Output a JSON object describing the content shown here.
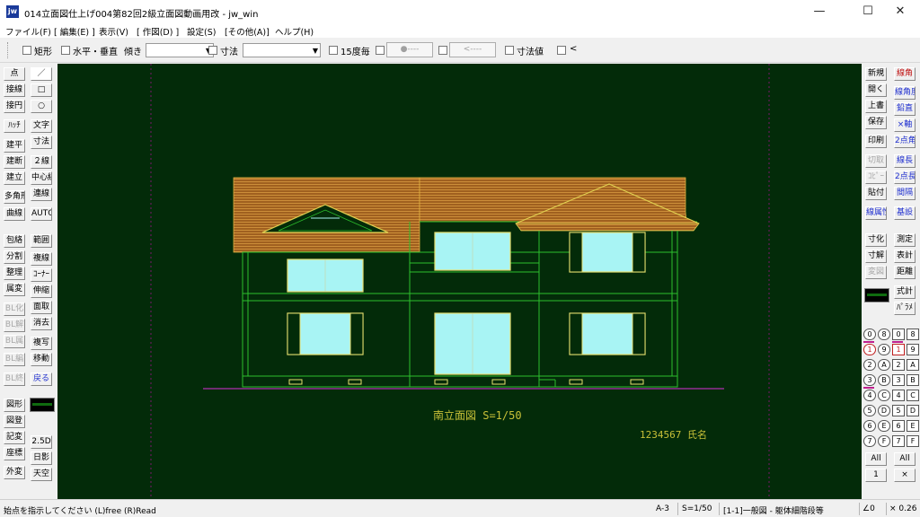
{
  "window": {
    "title": "014立面図仕上げ004第82回2級立面図動画用改 - jw_win",
    "app_icon": "jw",
    "controls": {
      "minimize": "—",
      "maximize": "☐",
      "close": "✕"
    }
  },
  "menu": [
    "ファイル(F)",
    "[ 編集(E) ]",
    "表示(V)",
    "[ 作図(D) ]",
    "設定(S)",
    "[その他(A)]",
    "ヘルプ(H)"
  ],
  "toolbar": {
    "rectangle": "矩形",
    "horiz_vert": "水平・垂直",
    "slope_label": "傾き",
    "slope_value": "",
    "dimension_label": "寸法",
    "dimension_value": "",
    "degree15": "15度毎",
    "btn_point": "●‐‐‐‐",
    "btn_arrow": "<‐‐‐‐",
    "dim_value": "寸法値",
    "lt": "<"
  },
  "left_panel": {
    "col1": [
      "点",
      "接線",
      "接円",
      "ﾊｯﾁ",
      "建平",
      "建断",
      "建立",
      "多角形",
      "曲線",
      "包絡",
      "分割",
      "整理",
      "属変",
      "BL化",
      "BL解",
      "BL属",
      "BL編",
      "BL終",
      "図形",
      "図登",
      "記変",
      "座標",
      "外変"
    ],
    "col2": [
      "／",
      "□",
      "○",
      "文字",
      "寸法",
      "２線",
      "中心線",
      "連線",
      "AUTO",
      "範囲",
      "複線",
      "ｺｰﾅｰ",
      "伸縮",
      "面取",
      "消去",
      "複写",
      "移動",
      "戻る",
      "2.5D",
      "日影",
      "天空"
    ]
  },
  "right_panel": {
    "col1": [
      "新規",
      "開く",
      "上書",
      "保存",
      "印刷",
      "切取",
      "ｺﾋﾟｰ",
      "貼付",
      "線属性",
      "寸化",
      "寸解",
      "変図",
      "All",
      "1"
    ],
    "col2": [
      "線角",
      "線角度",
      "鉛直",
      "×軸",
      "2点角",
      "線長",
      "2点長",
      "間隔",
      "基設",
      "測定",
      "表計",
      "距離",
      "式計",
      "ﾊﾟﾗﾒ",
      "All",
      "×"
    ],
    "layer_groups_circle": [
      "0",
      "1",
      "2",
      "3",
      "4",
      "5",
      "6",
      "7"
    ],
    "layer_groups_circle2": [
      "8",
      "9",
      "A",
      "B",
      "C",
      "D",
      "E",
      "F"
    ],
    "layers_a": [
      "0",
      "1",
      "2",
      "3",
      "4",
      "5",
      "6",
      "7"
    ],
    "layers_b": [
      "8",
      "9",
      "A",
      "B",
      "C",
      "D",
      "E",
      "F"
    ]
  },
  "drawing": {
    "view_title": "南立面図 S=1/50",
    "author": "1234567 氏名"
  },
  "status": {
    "message": "始点を指示してください (L)free (R)Read",
    "paper": "A-3",
    "scale": "S=1/50",
    "layer": "[1-1]一般図 - 躯体細階段等",
    "angle": "∠0",
    "zoom": "× 0.26"
  },
  "colors": {
    "canvas_bg": "#032b09",
    "wall_line": "#2dbf2d",
    "roof_tile": "#b8702a",
    "glass": "#a8f4f4",
    "frame": "#e8e070",
    "text_yellow": "#c8c038"
  }
}
